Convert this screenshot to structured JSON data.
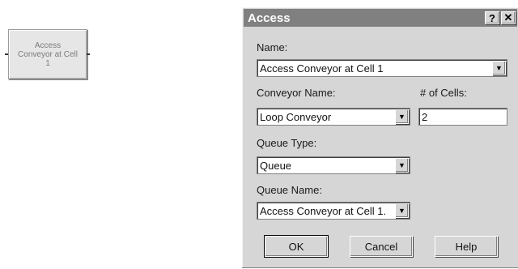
{
  "module": {
    "label": "Access\nConveyor at Cell\n1"
  },
  "dialog": {
    "title": "Access",
    "help_glyph": "?",
    "close_glyph": "✕",
    "name_label": "Name:",
    "name_value": "Access Conveyor at Cell 1",
    "conveyor_name_label": "Conveyor Name:",
    "conveyor_name_value": "Loop Conveyor",
    "num_cells_label": "# of Cells:",
    "num_cells_value": "2",
    "queue_type_label": "Queue Type:",
    "queue_type_value": "Queue",
    "queue_name_label": "Queue Name:",
    "queue_name_value": "Access Conveyor at Cell 1.",
    "buttons": {
      "ok": "OK",
      "cancel": "Cancel",
      "help": "Help"
    }
  },
  "icons": {
    "dropdown": "chevron-down-icon"
  }
}
